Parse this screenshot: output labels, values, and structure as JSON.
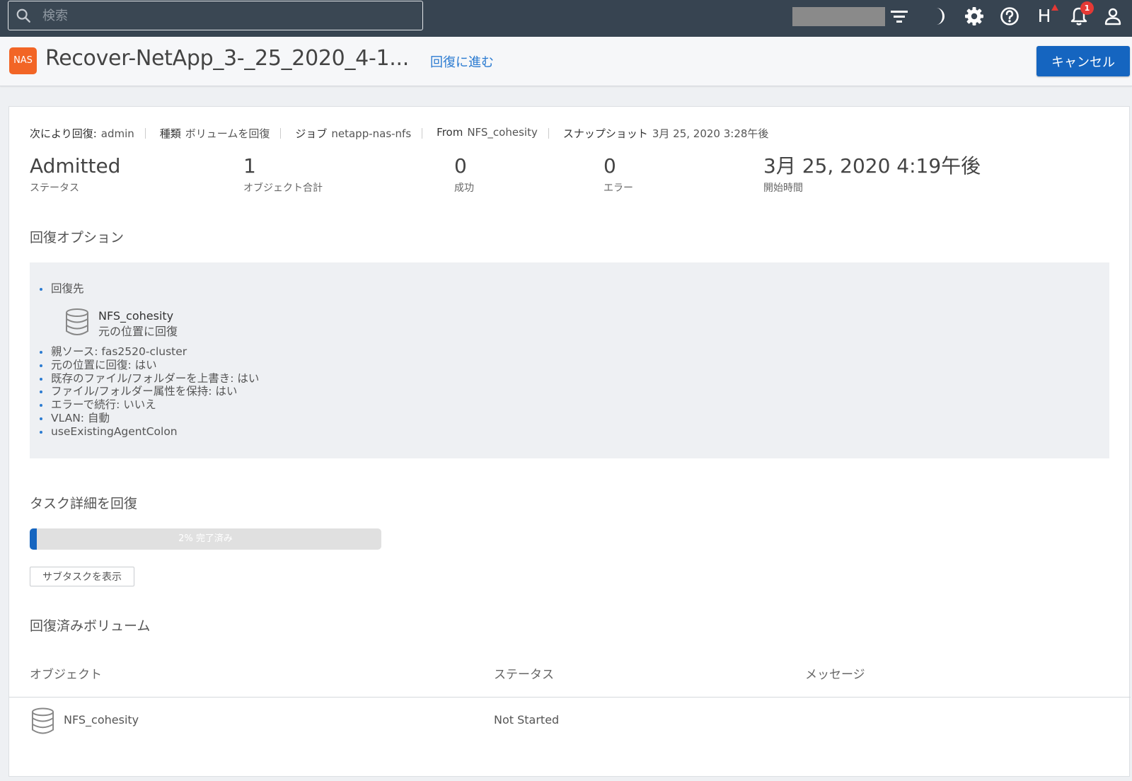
{
  "topbar": {
    "search_placeholder": "検索",
    "icons": [
      "search-icon",
      "filter-icon",
      "moon-icon",
      "gear-icon",
      "help-icon",
      "h-icon",
      "bell-icon",
      "user-icon"
    ],
    "h_label": "H",
    "notification_count": "1"
  },
  "header": {
    "object_type_tag": "NAS",
    "title": "Recover-NetApp_3-_25_2020_4-1...",
    "proceed_link": "回復に進む",
    "cancel_button": "キャンセル"
  },
  "meta": {
    "recovered_by_label": "次により回復:",
    "recovered_by_value": "admin",
    "type_label": "種類",
    "type_value": "ボリュームを回復",
    "job_label": "ジョブ",
    "job_value": "netapp-nas-nfs",
    "from_label": "From",
    "from_value": "NFS_cohesity",
    "snapshot_label": "スナップショット",
    "snapshot_value": "3月 25, 2020 3:28午後"
  },
  "stats": [
    {
      "value": "Admitted",
      "label": "ステータス"
    },
    {
      "value": "1",
      "label": "オブジェクト合計"
    },
    {
      "value": "0",
      "label": "成功"
    },
    {
      "value": "0",
      "label": "エラー"
    },
    {
      "value": "3月 25, 2020 4:19午後",
      "label": "開始時間"
    }
  ],
  "recovery_options": {
    "title": "回復オプション",
    "destination_label": "回復先",
    "destination_name": "NFS_cohesity",
    "destination_sub": "元の位置に回復",
    "items": [
      "親ソース: fas2520-cluster",
      "元の位置に回復: はい",
      "既存のファイル/フォルダーを上書き: はい",
      "ファイル/フォルダー属性を保持: はい",
      "エラーで続行: いいえ",
      "VLAN: 自動",
      "useExistingAgentColon"
    ]
  },
  "task": {
    "title": "タスク詳細を回復",
    "progress_percent": 2,
    "progress_text": "2% 完了済み",
    "subtask_button": "サブタスクを表示"
  },
  "volumes": {
    "title": "回復済みボリューム",
    "columns": [
      "オブジェクト",
      "ステータス",
      "メッセージ"
    ],
    "rows": [
      {
        "object": "NFS_cohesity",
        "status": "Not Started",
        "message": ""
      }
    ]
  },
  "colors": {
    "topbar_bg": "#374451",
    "accent_blue": "#1565c0",
    "nas_orange": "#f26526",
    "alert_red": "#e53935"
  }
}
